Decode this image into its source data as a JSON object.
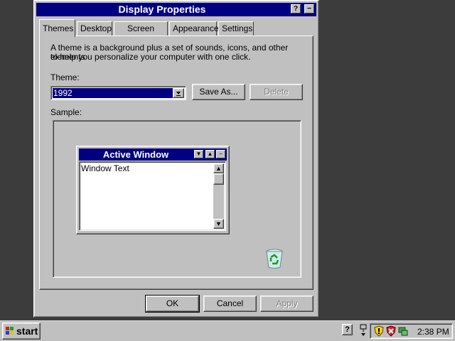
{
  "dialog": {
    "title": "Display Properties",
    "help_button": "?",
    "close_button": "−",
    "tabs": [
      {
        "label": "Themes",
        "active": true
      },
      {
        "label": "Desktop",
        "active": false
      },
      {
        "label": "Screen Saver",
        "active": false
      },
      {
        "label": "Appearance",
        "active": false
      },
      {
        "label": "Settings",
        "active": false
      }
    ],
    "description_line1": "A theme is a background plus a set of sounds, icons, and other elements",
    "description_line2": "to help you personalize your computer with one click.",
    "theme_label": "Theme:",
    "theme_value": "1992",
    "save_as_label": "Save As...",
    "delete_label": "Delete",
    "sample_label": "Sample:",
    "sample_window": {
      "title": "Active Window",
      "text": "Window Text"
    },
    "ok_label": "OK",
    "cancel_label": "Cancel",
    "apply_label": "Apply"
  },
  "taskbar": {
    "start_label": "start",
    "clock": "2:38 PM"
  },
  "colors": {
    "desktop": "#3c3c3c",
    "face": "#c0c0c0",
    "titlebar": "#000080",
    "selection": "#000080"
  }
}
